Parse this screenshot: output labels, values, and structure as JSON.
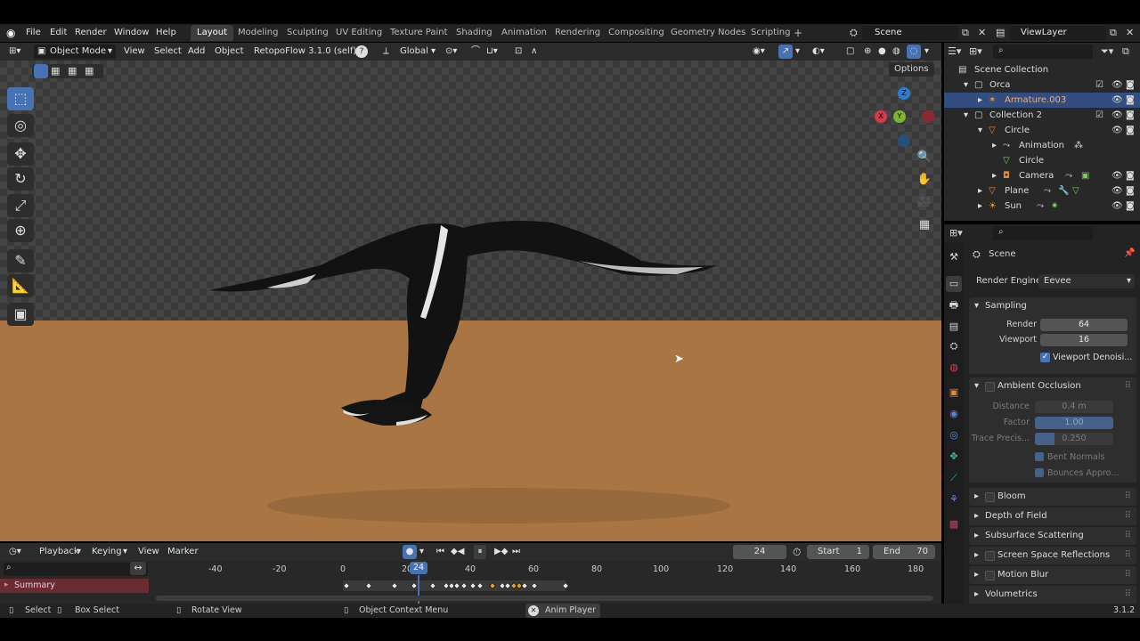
{
  "menus": [
    "File",
    "Edit",
    "Render",
    "Window",
    "Help"
  ],
  "workspaces": [
    "Layout",
    "Modeling",
    "Sculpting",
    "UV Editing",
    "Texture Paint",
    "Shading",
    "Animation",
    "Rendering",
    "Compositing",
    "Geometry Nodes",
    "Scripting"
  ],
  "add_tab": "+",
  "scene_name": "Scene",
  "view_layer": "ViewLayer",
  "viewport_header": {
    "mode": "Object Mode",
    "items": [
      "View",
      "Select",
      "Add",
      "Object"
    ],
    "addon": "RetopoFlow 3.1.0 (self)",
    "orientation": "Global",
    "options": "Options"
  },
  "gizmo": {
    "z": "Z",
    "y": "Y",
    "x": "X"
  },
  "outliner": {
    "root": "Scene Collection",
    "rows": [
      {
        "label": "Orca",
        "icon": "collection-icon"
      },
      {
        "label": "Armature.003",
        "icon": "armature-icon",
        "selected": true
      },
      {
        "label": "Collection 2",
        "icon": "collection-icon"
      },
      {
        "label": "Circle",
        "icon": "mesh-icon"
      },
      {
        "label": "Animation",
        "icon": "action-icon"
      },
      {
        "label": "Circle",
        "icon": "mesh-data-icon"
      },
      {
        "label": "Camera",
        "icon": "camera-icon"
      },
      {
        "label": "Plane",
        "icon": "mesh-icon"
      },
      {
        "label": "Sun",
        "icon": "light-icon"
      }
    ]
  },
  "properties": {
    "context": "Scene",
    "render_engine_label": "Render Engine",
    "render_engine": "Eevee",
    "sampling": {
      "title": "Sampling",
      "render_label": "Render",
      "render": "64",
      "viewport_label": "Viewport",
      "viewport": "16",
      "denoise": "Viewport Denoisi..."
    },
    "ao": {
      "title": "Ambient Occlusion",
      "distance_label": "Distance",
      "distance": "0.4 m",
      "factor_label": "Factor",
      "factor": "1.00",
      "trace_label": "Trace Precis...",
      "trace": "0.250",
      "bent": "Bent Normals",
      "bounces": "Bounces Appro..."
    },
    "panels": [
      "Bloom",
      "Depth of Field",
      "Subsurface Scattering",
      "Screen Space Reflections",
      "Motion Blur",
      "Volumetrics"
    ]
  },
  "timeline": {
    "menus": [
      "Playback",
      "Keying",
      "View",
      "Marker"
    ],
    "current_frame": "24",
    "start_label": "Start",
    "start": "1",
    "end_label": "End",
    "end": "70",
    "ticks": [
      "-40",
      "-20",
      "0",
      "20",
      "40",
      "60",
      "80",
      "100",
      "120",
      "140",
      "160",
      "180"
    ],
    "playhead": "24",
    "summary": "Summary"
  },
  "status": {
    "select": "Select",
    "box_select": "Box Select",
    "rotate": "Rotate View",
    "context_menu": "Object Context Menu",
    "anim_player": "Anim Player",
    "version": "3.1.2"
  },
  "colors": {
    "accent": "#4772b3",
    "ground": "#a87543",
    "selected_row": "#334d80"
  }
}
